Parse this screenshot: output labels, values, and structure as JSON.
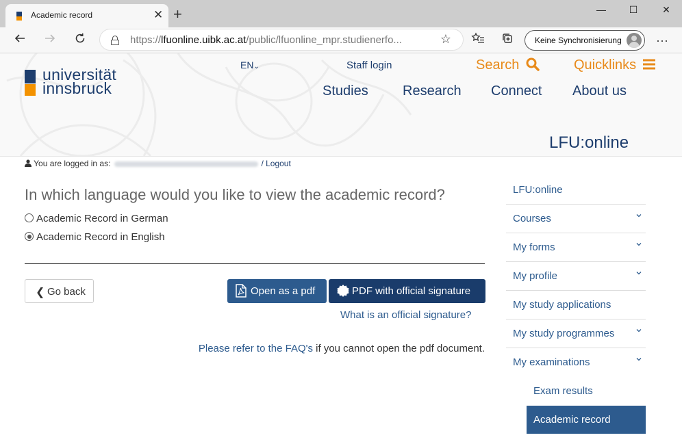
{
  "browser": {
    "tab_title": "Academic record",
    "url_prefix": "https://",
    "url_host": "lfuonline.uibk.ac.at",
    "url_path": "/public/lfuonline_mpr.studienerfo...",
    "sync_label": "Keine Synchronisierung",
    "icons": [
      "back-icon",
      "forward-icon",
      "refresh-icon",
      "lock-icon",
      "star-icon",
      "favorites-icon",
      "collections-icon",
      "more-icon"
    ]
  },
  "header": {
    "logo_line1": "universität",
    "logo_line2": "innsbruck",
    "lang": "EN",
    "staff_login": "Staff login",
    "search": "Search",
    "quicklinks": "Quicklinks",
    "nav": [
      "Studies",
      "Research",
      "Connect",
      "About us"
    ],
    "portal_title": "LFU:online"
  },
  "login": {
    "prefix": "You are logged in as:",
    "logout": "/ Logout"
  },
  "main": {
    "question": "In which language would you like to view the academic record?",
    "options": [
      {
        "label": "Academic Record in German",
        "checked": false
      },
      {
        "label": "Academic Record in English",
        "checked": true
      }
    ],
    "back_button": "Go back",
    "pdf_button": "Open as a pdf",
    "signature_button": "PDF with official signature",
    "what_is_link": "What is an official signature?",
    "faq_link": "Please refer to the FAQ's",
    "faq_rest": " if you cannot open the pdf document."
  },
  "sidebar": {
    "items": [
      {
        "label": "LFU:online"
      },
      {
        "label": "Courses"
      },
      {
        "label": "My forms"
      },
      {
        "label": "My profile"
      },
      {
        "label": "My study applications"
      },
      {
        "label": "My study programmes"
      },
      {
        "label": "My examinations"
      }
    ],
    "sub_item": "Exam results",
    "active_item": "Academic record"
  },
  "colors": {
    "brand_blue": "#1d3d6d",
    "brand_orange": "#f39200",
    "button_blue": "#2d5b8e"
  }
}
